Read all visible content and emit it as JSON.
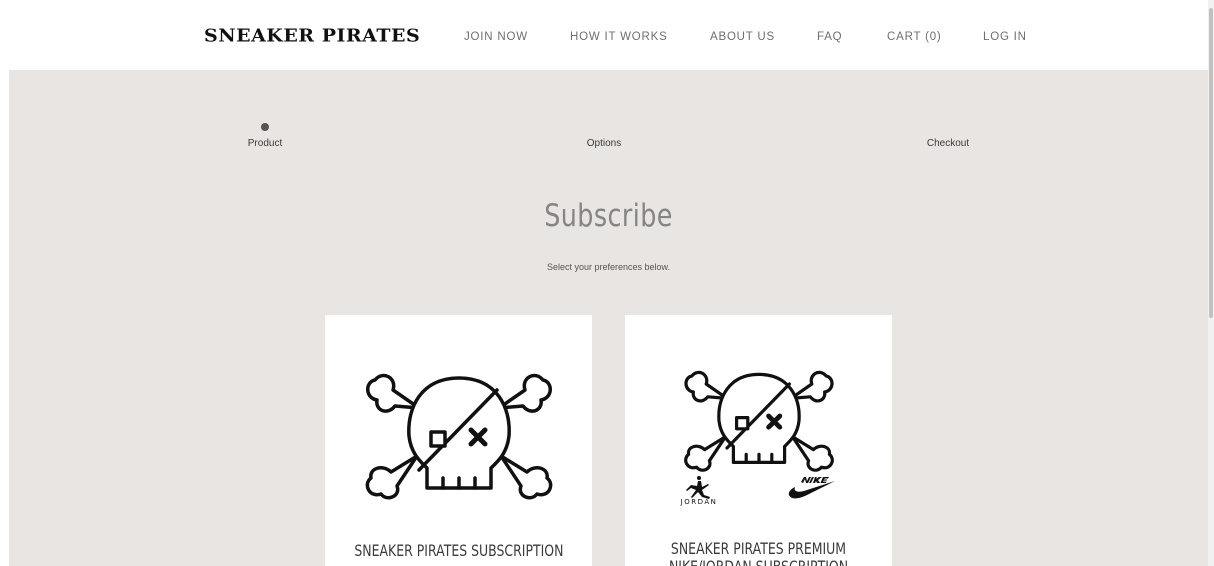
{
  "header": {
    "logo": "SNEAKER PIRATES",
    "nav": [
      {
        "label": "JOIN NOW"
      },
      {
        "label": "HOW IT WORKS"
      },
      {
        "label": "ABOUT US"
      },
      {
        "label": "FAQ"
      },
      {
        "label": "CART (0)"
      },
      {
        "label": "LOG IN"
      }
    ]
  },
  "steps": [
    {
      "label": "Product",
      "active": true
    },
    {
      "label": "Options",
      "active": false
    },
    {
      "label": "Checkout",
      "active": false
    }
  ],
  "main": {
    "title": "Subscribe",
    "subtitle": "Select your preferences below."
  },
  "cards": [
    {
      "title_line1": "SNEAKER PIRATES SUBSCRIPTION",
      "title_line2": ""
    },
    {
      "title_line1": "SNEAKER PIRATES PREMIUM",
      "title_line2": "NIKE/JORDAN SUBSCRIPTION",
      "brand_left": "JORDAN"
    }
  ],
  "colors": {
    "background_main": "#e8e5e2",
    "card": "#ffffff",
    "text_dark": "#111111",
    "nav_text": "#6f6f6f"
  },
  "icons": [
    "skull-crossbones-icon",
    "jumpman-logo-icon",
    "nike-logo-icon"
  ]
}
